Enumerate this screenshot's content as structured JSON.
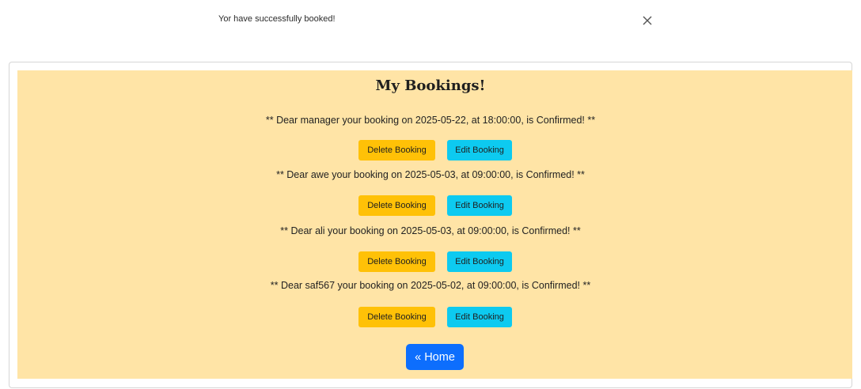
{
  "alert": {
    "message": "Yor have successfully booked!",
    "close_icon": "close-icon"
  },
  "bookings": {
    "title": "My Bookings!",
    "items": [
      {
        "text": "** Dear manager your booking on 2025-05-22, at 18:00:00, is Confirmed! **",
        "delete_label": "Delete Booking",
        "edit_label": "Edit Booking"
      },
      {
        "text": "** Dear awe your booking on 2025-05-03, at 09:00:00, is Confirmed! **",
        "delete_label": "Delete Booking",
        "edit_label": "Edit Booking"
      },
      {
        "text": "** Dear ali your booking on 2025-05-03, at 09:00:00, is Confirmed! **",
        "delete_label": "Delete Booking",
        "edit_label": "Edit Booking"
      },
      {
        "text": "** Dear saf567 your booking on 2025-05-02, at 09:00:00, is Confirmed! **",
        "delete_label": "Delete Booking",
        "edit_label": "Edit Booking"
      }
    ],
    "home_label": "« Home"
  },
  "colors": {
    "panel_bg": "#ffe4a6",
    "delete_btn": "#ffc107",
    "edit_btn": "#0dcaf0",
    "home_btn": "#0d6efd"
  }
}
